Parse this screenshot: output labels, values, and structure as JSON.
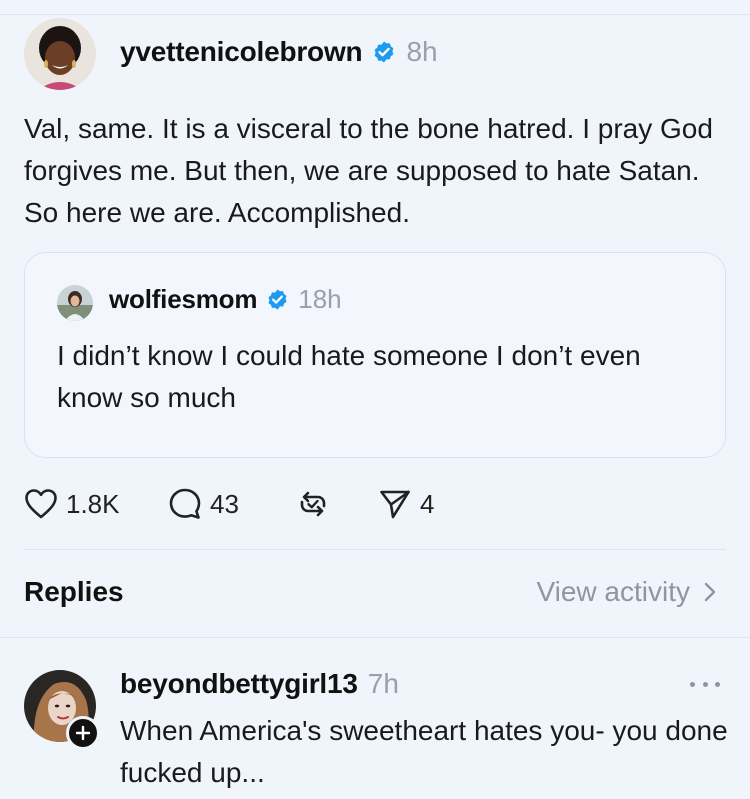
{
  "post": {
    "username": "yvettenicolebrown",
    "verified_icon": "verified-badge-icon",
    "timestamp": "8h",
    "text": "Val, same. It is a visceral to the bone hatred. I pray God forgives me. But then, we are supposed to hate Satan. So here we are. Accomplished."
  },
  "quoted_post": {
    "username": "wolfiesmom",
    "verified_icon": "verified-badge-icon",
    "timestamp": "18h",
    "text": "I didn’t know I could hate someone I don’t even know so much"
  },
  "actions": {
    "like_count": "1.8K",
    "reply_count": "43",
    "share_count": "4"
  },
  "replies_section": {
    "heading": "Replies",
    "view_activity": "View activity"
  },
  "reply": {
    "username": "beyondbettygirl13",
    "timestamp": "7h",
    "text": "When America's sweetheart hates you- you done fucked up..."
  },
  "colors": {
    "background": "#f0f5fc",
    "verified_blue": "#1d9bf0",
    "muted_text": "#97a0ab"
  }
}
